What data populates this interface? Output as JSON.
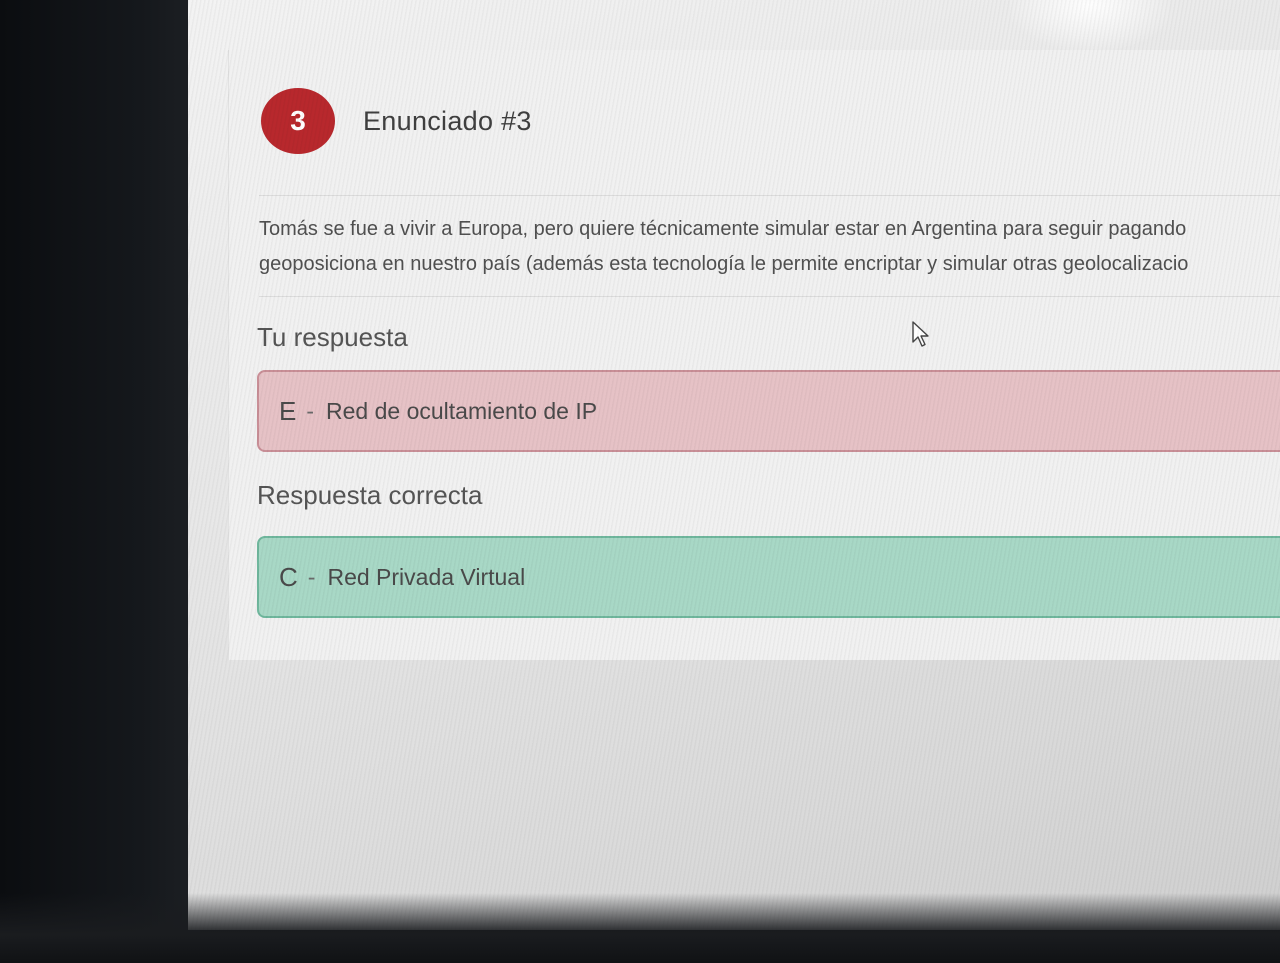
{
  "question": {
    "number": "3",
    "title": "Enunciado #3",
    "statement_lines": [
      "Tomás se fue a vivir a Europa, pero quiere técnicamente simular estar en Argentina para seguir pagando",
      "geoposiciona en nuestro país (además esta tecnología le permite encriptar y simular otras geolocalizacio"
    ]
  },
  "your_answer": {
    "label": "Tu respuesta",
    "letter": "E",
    "separator": "-",
    "text": "Red de ocultamiento de IP",
    "status_color": "#e6c2c6"
  },
  "correct_answer": {
    "label": "Respuesta correcta",
    "letter": "C",
    "separator": "-",
    "text": "Red Privada Virtual",
    "status_color": "#a8d8c6"
  },
  "colors": {
    "badge": "#b8282d",
    "wrong_border": "#c98f97",
    "right_border": "#6fb79d"
  },
  "icons": {
    "cursor": "mouse-pointer-icon"
  }
}
